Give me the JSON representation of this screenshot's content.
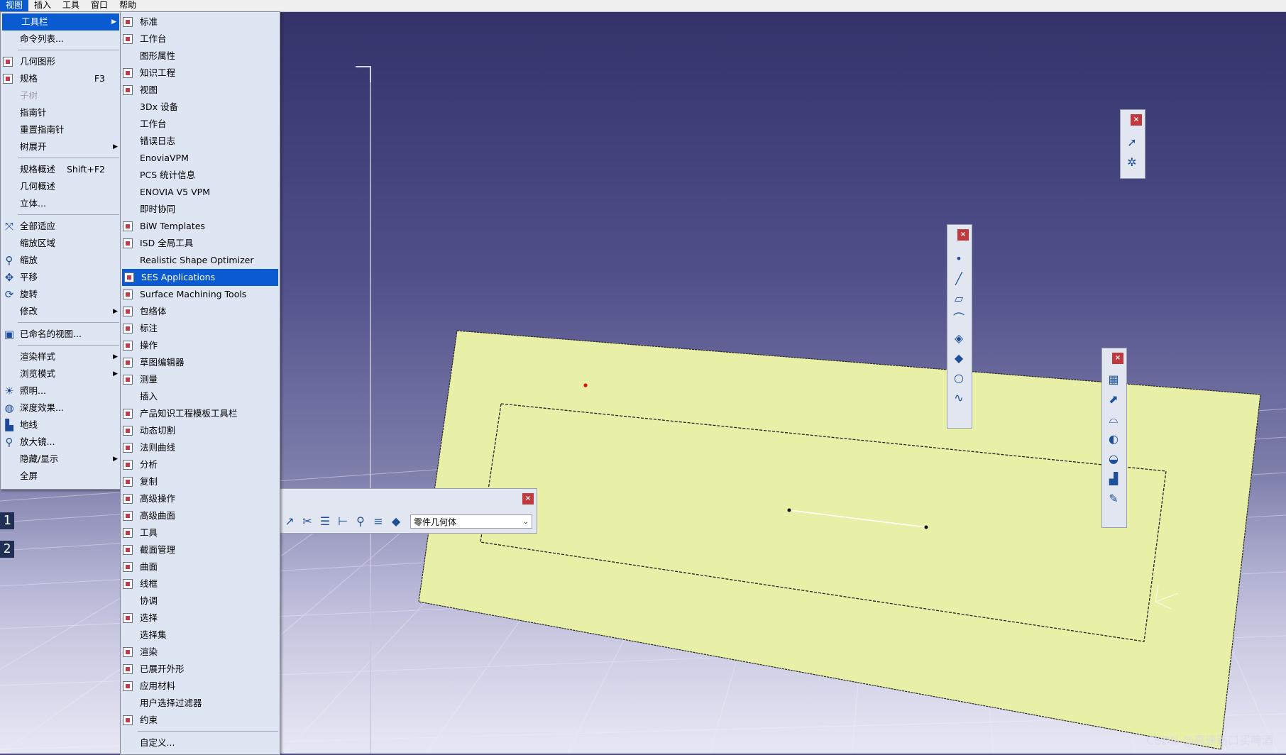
{
  "menubar": {
    "items": [
      "视图",
      "插入",
      "工具",
      "窗口",
      "帮助"
    ]
  },
  "menu1": {
    "items": [
      {
        "label": "工具栏",
        "arrow": true,
        "highlight": true
      },
      {
        "label": "命令列表..."
      },
      {
        "sep": true
      },
      {
        "label": "几何图形",
        "check": true
      },
      {
        "label": "规格",
        "check": true,
        "shortcut": "F3"
      },
      {
        "label": "子树",
        "disabled": true
      },
      {
        "label": "指南针"
      },
      {
        "label": "重置指南针"
      },
      {
        "label": "树展开",
        "arrow": true
      },
      {
        "sep": true
      },
      {
        "label": "规格概述",
        "shortcut": "Shift+F2"
      },
      {
        "label": "几何概述"
      },
      {
        "label": "立体..."
      },
      {
        "sep": true
      },
      {
        "label": "全部适应",
        "icon": "fit-all-icon",
        "glyph": "⤧"
      },
      {
        "label": "缩放区域"
      },
      {
        "label": "缩放",
        "icon": "zoom-icon",
        "glyph": "⚲"
      },
      {
        "label": "平移",
        "icon": "pan-icon",
        "glyph": "✥"
      },
      {
        "label": "旋转",
        "icon": "rotate-icon",
        "glyph": "⟳"
      },
      {
        "label": "修改",
        "arrow": true
      },
      {
        "sep": true
      },
      {
        "label": "已命名的视图...",
        "icon": "named-views-icon",
        "glyph": "▣"
      },
      {
        "sep": true
      },
      {
        "label": "渲染样式",
        "arrow": true
      },
      {
        "label": "浏览模式",
        "arrow": true
      },
      {
        "label": "照明...",
        "icon": "lighting-icon",
        "glyph": "☀"
      },
      {
        "label": "深度效果...",
        "icon": "depth-effect-icon",
        "glyph": "◍"
      },
      {
        "label": "地线",
        "icon": "ground-icon",
        "glyph": "▙"
      },
      {
        "label": "放大镜...",
        "icon": "magnifier-icon",
        "glyph": "⚲"
      },
      {
        "label": "隐藏/显示",
        "arrow": true
      },
      {
        "label": "全屏"
      }
    ]
  },
  "menu2": {
    "items": [
      {
        "label": "标准",
        "check": true
      },
      {
        "label": "工作台",
        "check": true
      },
      {
        "label": "图形属性"
      },
      {
        "label": "知识工程",
        "check": true
      },
      {
        "label": "视图",
        "check": true
      },
      {
        "label": "3Dx 设备"
      },
      {
        "label": "工作台"
      },
      {
        "label": "错误日志"
      },
      {
        "label": "EnoviaVPM"
      },
      {
        "label": "PCS 统计信息"
      },
      {
        "label": "ENOVIA V5 VPM"
      },
      {
        "label": "即时协同"
      },
      {
        "label": "BiW Templates",
        "check": true
      },
      {
        "label": "ISD 全局工具",
        "check": true
      },
      {
        "label": "Realistic Shape Optimizer"
      },
      {
        "label": "SES Applications",
        "check": true,
        "highlight": true
      },
      {
        "label": "Surface Machining Tools",
        "check": true
      },
      {
        "label": "包络体",
        "check": true
      },
      {
        "label": "标注",
        "check": true
      },
      {
        "label": "操作",
        "check": true
      },
      {
        "label": "草图编辑器",
        "check": true
      },
      {
        "label": "测量",
        "check": true
      },
      {
        "label": "插入"
      },
      {
        "label": "产品知识工程模板工具栏",
        "check": true
      },
      {
        "label": "动态切割",
        "check": true
      },
      {
        "label": "法则曲线",
        "check": true
      },
      {
        "label": "分析",
        "check": true
      },
      {
        "label": "复制",
        "check": true
      },
      {
        "label": "高级操作",
        "check": true
      },
      {
        "label": "高级曲面",
        "check": true
      },
      {
        "label": "工具",
        "check": true
      },
      {
        "label": "截面管理",
        "check": true
      },
      {
        "label": "曲面",
        "check": true
      },
      {
        "label": "线框",
        "check": true
      },
      {
        "label": "协调"
      },
      {
        "label": "选择",
        "check": true
      },
      {
        "label": "选择集"
      },
      {
        "label": "渲染",
        "check": true
      },
      {
        "label": "已展开外形",
        "check": true
      },
      {
        "label": "应用材料",
        "check": true
      },
      {
        "label": "用户选择过滤器"
      },
      {
        "label": "约束",
        "check": true
      },
      {
        "sep": true
      },
      {
        "label": "自定义..."
      }
    ]
  },
  "hbar": {
    "combo_value": "零件几何体",
    "icons": [
      {
        "icon": "axis-icon",
        "glyph": "↗"
      },
      {
        "icon": "trim-icon",
        "glyph": "✂"
      },
      {
        "icon": "feature-icon",
        "glyph": "☰"
      },
      {
        "icon": "tree-icon",
        "glyph": "⊢"
      },
      {
        "icon": "search-icon",
        "glyph": "⚲"
      },
      {
        "icon": "list-icon",
        "glyph": "≡"
      },
      {
        "icon": "body-icon",
        "glyph": "◆"
      }
    ]
  },
  "vbar_select": {
    "icons": [
      {
        "icon": "select-arrow-icon",
        "glyph": "➚"
      },
      {
        "icon": "selection-trap-icon",
        "glyph": "✲"
      }
    ]
  },
  "vbar_wireframe": {
    "icons": [
      {
        "icon": "point-icon",
        "glyph": "•"
      },
      {
        "icon": "line-icon",
        "glyph": "╱"
      },
      {
        "icon": "plane-icon",
        "glyph": "▱"
      },
      {
        "icon": "projection-icon",
        "glyph": "⌒"
      },
      {
        "icon": "intersection-icon",
        "glyph": "◈"
      },
      {
        "icon": "offset-icon",
        "glyph": "◆"
      },
      {
        "icon": "circle-icon",
        "glyph": "○"
      },
      {
        "icon": "spline-icon",
        "glyph": "∿"
      }
    ]
  },
  "vbar_surface": {
    "icons": [
      {
        "icon": "extrude-surface-icon",
        "glyph": "▦"
      },
      {
        "icon": "offset-surface-icon",
        "glyph": "⬈"
      },
      {
        "icon": "sweep-icon",
        "glyph": "⌓"
      },
      {
        "icon": "fill-icon",
        "glyph": "◐"
      },
      {
        "icon": "multi-section-icon",
        "glyph": "◒"
      },
      {
        "icon": "blend-icon",
        "glyph": "▟"
      },
      {
        "icon": "join-icon",
        "glyph": "✎"
      }
    ]
  },
  "tree_labels": [
    "1",
    "2"
  ],
  "watermark": "CSDN @高速路口买啤酒"
}
